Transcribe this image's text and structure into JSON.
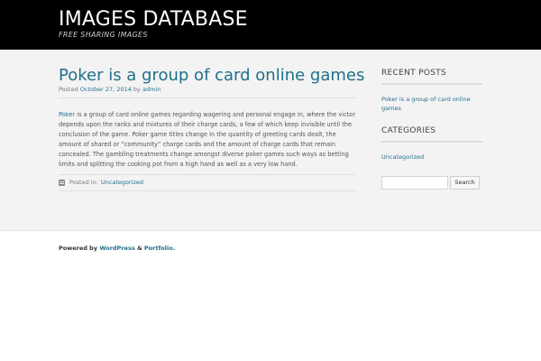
{
  "header": {
    "site_title": "IMAGES DATABASE",
    "site_description": "FREE SHARING IMAGES"
  },
  "post": {
    "title": "Poker is a group of card online games",
    "meta_posted": "Posted",
    "meta_date": "October 27, 2014",
    "meta_by": "by",
    "meta_author": "admin",
    "content_link": "Poker",
    "content_text": " is a group of card online games regarding wagering and personal engage in, where the victor depends upon the ranks and mixtures of their charge cards, a few of which keep invisible until the conclusion of the game. Poker game titles change in the quantity of greeting cards dealt, the amount of shared or “community” charge cards and the amount of charge cards that remain concealed. The gambling treatments change amongst diverse poker games such ways as betting limits and splitting the cooking pot from a high hand as well as a very low hand.",
    "posted_in_label": "Posted in:",
    "category": "Uncategorized"
  },
  "sidebar": {
    "recent_posts_title": "RECENT POSTS",
    "recent_posts": [
      "Poker is a group of card online games"
    ],
    "categories_title": "CATEGORIES",
    "categories": [
      "Uncategorized"
    ],
    "search_value": "",
    "search_button_label": "Search"
  },
  "footer": {
    "powered_by": "Powered by",
    "wordpress": "WordPress",
    "amp": "&",
    "theme": "Portfolio",
    "period": "."
  },
  "colors": {
    "header_bg": "#000000",
    "link": "#1f6f8b",
    "content_bg": "#f3f3f3"
  },
  "icons": {
    "posted_in": "folder-icon"
  }
}
